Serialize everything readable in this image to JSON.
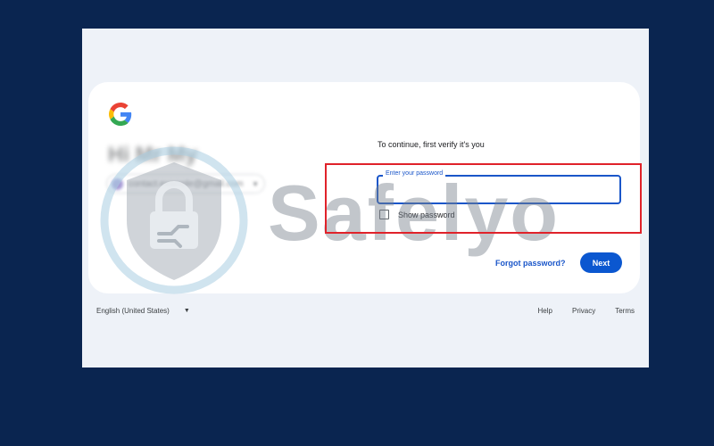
{
  "card": {
    "account_name_blurred": "Hi Mr My",
    "account_chip_blurred": "contact.example@gmail.com",
    "instruction": "To continue, first verify it's you",
    "password": {
      "label": "Enter your password",
      "value": "",
      "show_password_label": "Show password"
    },
    "forgot_label": "Forgot password?",
    "next_label": "Next"
  },
  "footer": {
    "language": "English (United States)",
    "links": [
      "Help",
      "Privacy",
      "Terms"
    ]
  },
  "watermark": {
    "text": "Safelyo",
    "icon": "shield-lock-icon"
  },
  "highlight": {
    "color": "#e0222a"
  },
  "colors": {
    "background": "#0a2550",
    "accent": "#0b57d0",
    "link": "#1a56c9"
  },
  "icons": {
    "brand": "google-logo-icon",
    "dropdown": "caret-down-icon"
  }
}
